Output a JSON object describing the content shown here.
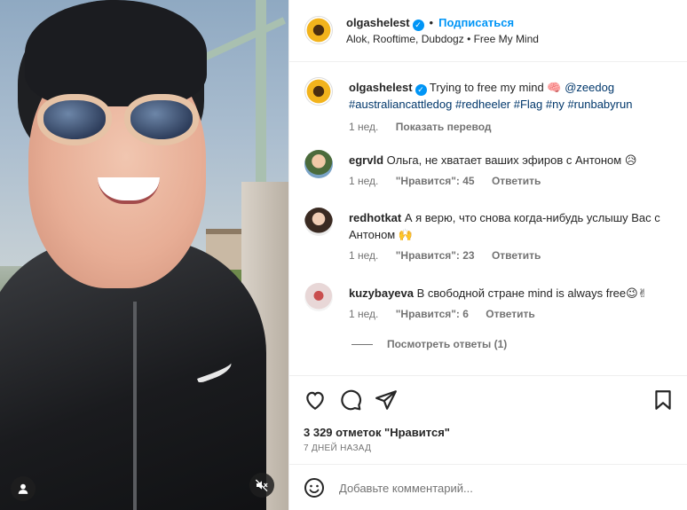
{
  "post": {
    "author": "olgashelest",
    "follow_label": "Подписаться",
    "audio": "Alok, Rooftime, Dubdogz • Free My Mind",
    "caption": {
      "text": "Trying to free my mind",
      "emoji": "🧠",
      "mention": "@zeedog",
      "hashtags": "#australiancattledog #redheeler #Flag #ny #runbabyrun"
    },
    "caption_time": "1 нед.",
    "translate_label": "Показать перевод"
  },
  "comments": [
    {
      "user": "egrvld",
      "text": "Ольга, не хватает ваших эфиров с Антоном 😥",
      "time": "1 нед.",
      "likes": "\"Нравится\": 45",
      "reply": "Ответить"
    },
    {
      "user": "redhotkat",
      "text": "А я верю, что снова когда-нибудь услышу Вас с Антоном 🙌",
      "time": "1 нед.",
      "likes": "\"Нравится\": 23",
      "reply": "Ответить"
    },
    {
      "user": "kuzybayeva",
      "text": "В свободной стране mind is always free😉✌",
      "time": "1 нед.",
      "likes": "\"Нравится\": 6",
      "reply": "Ответить"
    }
  ],
  "view_replies": "Посмотреть ответы (1)",
  "likes_count": "3 329 отметок \"Нравится\"",
  "date": "7 ДНЕЙ НАЗАД",
  "add_comment_placeholder": "Добавьте комментарий...",
  "colors": {
    "accent": "#0095f6",
    "muted": "#737373",
    "text": "#262626"
  }
}
